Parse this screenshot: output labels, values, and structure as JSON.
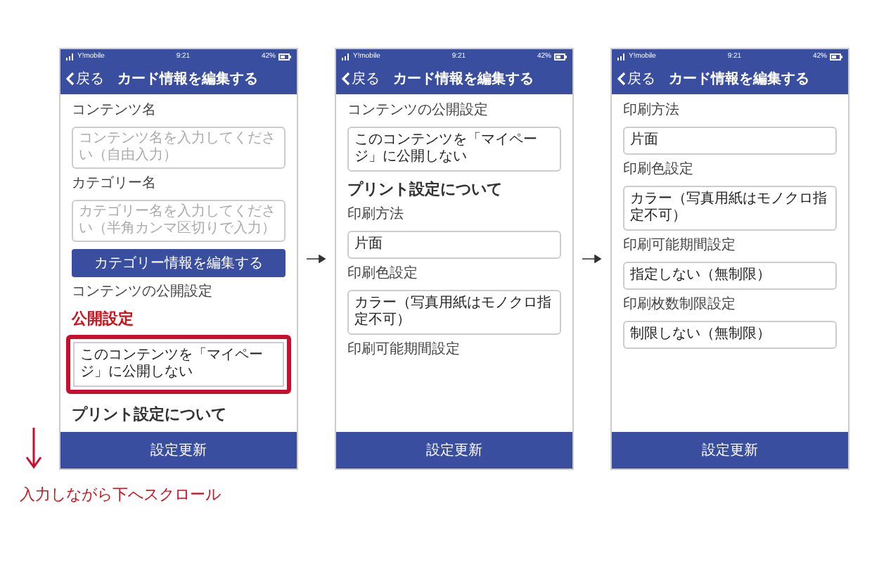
{
  "screens": [
    {
      "status_bar": {
        "carrier": "Y!mobile",
        "time": "9:21",
        "battery": "42%"
      },
      "header": {
        "back": "戻る",
        "title": "カード情報を編集する"
      },
      "items": [
        {
          "kind": "label",
          "text": "コンテンツ名"
        },
        {
          "kind": "input",
          "placeholder": "コンテンツ名を入力してください（自由入力）",
          "highlighted": false
        },
        {
          "kind": "label",
          "text": "カテゴリー名"
        },
        {
          "kind": "input",
          "placeholder": "カテゴリー名を入力してください（半角カンマ区切りで入力）",
          "highlighted": false
        },
        {
          "kind": "button",
          "text": "カテゴリー情報を編集する"
        },
        {
          "kind": "label",
          "text": "コンテンツの公開設定"
        },
        {
          "kind": "callout",
          "text": "公開設定"
        },
        {
          "kind": "select",
          "value": "このコンテンツを「マイページ」に公開しない",
          "highlighted": true
        },
        {
          "kind": "heading",
          "text": "プリント設定について"
        }
      ],
      "footer_button": "設定更新"
    },
    {
      "status_bar": {
        "carrier": "Y!mobile",
        "time": "9:21",
        "battery": "42%"
      },
      "header": {
        "back": "戻る",
        "title": "カード情報を編集する"
      },
      "items": [
        {
          "kind": "label",
          "text": "コンテンツの公開設定"
        },
        {
          "kind": "select",
          "value": "このコンテンツを「マイページ」に公開しない",
          "highlighted": false
        },
        {
          "kind": "heading",
          "text": "プリント設定について"
        },
        {
          "kind": "label",
          "text": "印刷方法"
        },
        {
          "kind": "select",
          "value": "片面",
          "highlighted": false
        },
        {
          "kind": "label",
          "text": "印刷色設定"
        },
        {
          "kind": "select",
          "value": "カラー（写真用紙はモノクロ指定不可）",
          "highlighted": false
        },
        {
          "kind": "label",
          "text": "印刷可能期間設定"
        }
      ],
      "footer_button": "設定更新"
    },
    {
      "status_bar": {
        "carrier": "Y!mobile",
        "time": "9:21",
        "battery": "42%"
      },
      "header": {
        "back": "戻る",
        "title": "カード情報を編集する"
      },
      "items": [
        {
          "kind": "label",
          "text": "印刷方法"
        },
        {
          "kind": "select",
          "value": "片面",
          "highlighted": false
        },
        {
          "kind": "label",
          "text": "印刷色設定"
        },
        {
          "kind": "select",
          "value": "カラー（写真用紙はモノクロ指定不可）",
          "highlighted": false
        },
        {
          "kind": "label",
          "text": "印刷可能期間設定"
        },
        {
          "kind": "select",
          "value": "指定しない（無制限）",
          "highlighted": false
        },
        {
          "kind": "label",
          "text": "印刷枚数制限設定"
        },
        {
          "kind": "select",
          "value": "制限しない（無制限）",
          "highlighted": false
        }
      ],
      "footer_button": "設定更新"
    }
  ],
  "caption": "入力しながら下へスクロール"
}
